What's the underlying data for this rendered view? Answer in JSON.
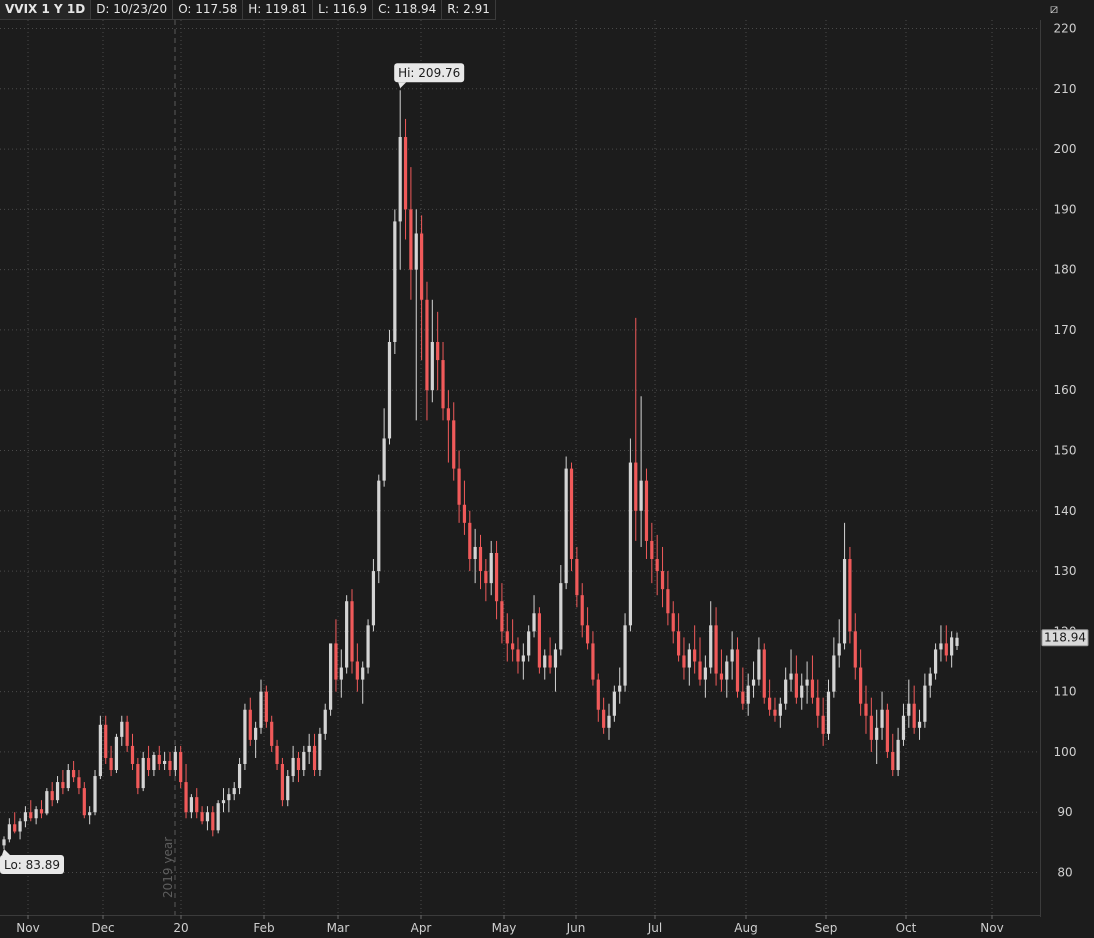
{
  "header": {
    "symbol": "VVIX 1 Y 1D",
    "date": "D: 10/23/20",
    "open": "O: 117.58",
    "high": "H: 119.81",
    "low": "L: 116.9",
    "close": "C: 118.94",
    "range": "R: 2.91"
  },
  "toolbar": {
    "icon": "style-icon"
  },
  "chart_data": {
    "type": "candlestick",
    "y_ticks": [
      "80",
      "90",
      "100",
      "110",
      "120",
      "130",
      "140",
      "150",
      "160",
      "170",
      "180",
      "190",
      "200",
      "210",
      "220"
    ],
    "ylim": [
      74.5,
      222.5
    ],
    "x_labels": [
      "Nov",
      "Dec",
      "20",
      "Feb",
      "Mar",
      "Apr",
      "May",
      "Jun",
      "Jul",
      "Aug",
      "Sep",
      "Oct",
      "Nov"
    ],
    "year_marker": "2019 year",
    "last_price": "118.94",
    "hi_label": "Hi: 209.76",
    "lo_label": "Lo: 83.89",
    "hi_value": 209.76,
    "lo_value": 83.89,
    "grid": true,
    "colors": {
      "up": "#d4d4d4",
      "down": "#f05a5a",
      "grid": "#4a4a4a",
      "background": "#1c1c1c",
      "axis_text": "#cfcfcf"
    },
    "candles": [
      [
        84.5,
        86,
        83.89,
        85.5
      ],
      [
        85.5,
        89,
        85,
        88
      ],
      [
        88,
        90,
        86.5,
        86.8
      ],
      [
        86.8,
        89,
        85.5,
        88.5
      ],
      [
        88.5,
        91,
        87.5,
        90
      ],
      [
        90,
        92,
        88.5,
        89
      ],
      [
        89,
        91,
        88,
        90.5
      ],
      [
        90.5,
        92,
        89,
        89.8
      ],
      [
        89.8,
        94,
        89.5,
        93.5
      ],
      [
        93.5,
        95,
        91,
        92
      ],
      [
        92,
        96,
        91.5,
        95
      ],
      [
        95,
        97,
        93,
        94
      ],
      [
        94,
        98,
        93.5,
        97
      ],
      [
        97,
        98.5,
        95,
        95.8
      ],
      [
        95.8,
        97,
        93,
        94
      ],
      [
        94,
        95,
        89,
        89.5
      ],
      [
        89.5,
        91,
        88,
        90
      ],
      [
        90,
        97,
        89.5,
        96
      ],
      [
        96,
        106,
        95.5,
        104.5
      ],
      [
        104.5,
        106,
        98,
        99
      ],
      [
        99,
        101,
        96,
        97
      ],
      [
        97,
        103,
        96.5,
        102.5
      ],
      [
        102.5,
        106,
        101,
        105
      ],
      [
        105,
        106,
        100,
        101
      ],
      [
        101,
        103,
        97,
        98
      ],
      [
        98,
        99,
        93,
        94
      ],
      [
        94,
        100,
        93.5,
        99
      ],
      [
        99,
        101,
        96,
        97
      ],
      [
        97,
        100,
        96,
        99.5
      ],
      [
        99.5,
        101,
        97,
        98
      ],
      [
        98,
        100,
        97,
        98.5
      ],
      [
        98.5,
        100,
        96,
        97
      ],
      [
        97,
        101,
        96,
        100
      ],
      [
        100,
        101,
        94,
        95
      ],
      [
        95,
        98,
        89,
        90
      ],
      [
        90,
        93,
        89,
        92.5
      ],
      [
        92.5,
        94,
        89,
        90
      ],
      [
        90,
        91,
        88,
        88.5
      ],
      [
        88.5,
        91,
        87,
        90
      ],
      [
        90,
        91,
        86,
        87
      ],
      [
        87,
        92,
        86.5,
        91.5
      ],
      [
        91.5,
        94,
        90,
        92
      ],
      [
        92,
        94,
        90,
        93
      ],
      [
        93,
        95,
        92,
        94
      ],
      [
        94,
        99,
        93,
        98
      ],
      [
        98,
        108,
        97,
        107
      ],
      [
        107,
        109,
        101,
        102
      ],
      [
        102,
        105,
        99,
        104
      ],
      [
        104,
        112,
        103,
        110
      ],
      [
        110,
        111,
        104,
        105
      ],
      [
        105,
        106,
        100,
        101
      ],
      [
        101,
        102,
        97,
        98
      ],
      [
        98,
        99,
        91,
        92
      ],
      [
        92,
        97,
        91,
        96
      ],
      [
        96,
        101,
        95,
        99
      ],
      [
        99,
        100,
        95,
        97
      ],
      [
        97,
        101,
        96,
        100
      ],
      [
        100,
        103,
        98,
        101
      ],
      [
        101,
        103,
        96,
        97
      ],
      [
        97,
        104,
        96,
        103
      ],
      [
        103,
        108,
        102,
        107
      ],
      [
        107,
        115,
        106,
        118
      ],
      [
        118,
        122,
        110,
        112
      ],
      [
        112,
        117,
        109,
        114
      ],
      [
        114,
        126,
        113,
        125
      ],
      [
        125,
        127,
        113,
        115
      ],
      [
        115,
        118,
        110,
        112
      ],
      [
        112,
        115,
        108,
        114
      ],
      [
        114,
        122,
        113,
        121
      ],
      [
        121,
        132,
        120,
        130
      ],
      [
        130,
        146,
        128,
        145
      ],
      [
        145,
        157,
        144,
        152
      ],
      [
        152,
        170,
        151,
        168
      ],
      [
        168,
        190,
        166,
        188
      ],
      [
        188,
        209.76,
        180,
        202
      ],
      [
        202,
        205,
        185,
        190
      ],
      [
        190,
        197,
        175,
        180
      ],
      [
        180,
        190,
        155,
        186
      ],
      [
        186,
        189,
        165,
        175
      ],
      [
        175,
        178,
        155,
        160
      ],
      [
        160,
        175,
        158,
        168
      ],
      [
        168,
        173,
        160,
        165
      ],
      [
        165,
        168,
        155,
        157
      ],
      [
        157,
        160,
        148,
        155
      ],
      [
        155,
        158,
        145,
        147
      ],
      [
        147,
        150,
        138,
        141
      ],
      [
        141,
        145,
        136,
        138
      ],
      [
        138,
        140,
        130,
        132
      ],
      [
        132,
        137,
        128,
        134
      ],
      [
        134,
        136,
        127,
        130
      ],
      [
        130,
        132,
        125,
        128
      ],
      [
        128,
        135,
        126,
        133
      ],
      [
        133,
        135,
        122,
        125
      ],
      [
        125,
        128,
        118,
        120
      ],
      [
        120,
        123,
        115,
        118
      ],
      [
        118,
        122,
        115,
        117
      ],
      [
        117,
        119,
        113,
        115
      ],
      [
        115,
        118,
        112,
        116
      ],
      [
        116,
        121,
        115,
        120
      ],
      [
        120,
        126,
        119,
        123
      ],
      [
        123,
        124,
        113,
        114
      ],
      [
        114,
        117,
        112,
        116
      ],
      [
        116,
        119,
        113,
        114
      ],
      [
        114,
        118,
        110,
        117
      ],
      [
        117,
        131,
        116,
        128
      ],
      [
        128,
        149,
        127,
        147
      ],
      [
        147,
        148,
        130,
        132
      ],
      [
        132,
        134,
        124,
        126
      ],
      [
        126,
        128,
        119,
        121
      ],
      [
        121,
        124,
        117,
        118
      ],
      [
        118,
        120,
        111,
        112
      ],
      [
        112,
        113,
        105,
        107
      ],
      [
        107,
        109,
        103,
        104
      ],
      [
        104,
        108,
        102,
        106
      ],
      [
        106,
        111,
        105,
        110
      ],
      [
        110,
        114,
        108,
        111
      ],
      [
        111,
        123,
        110,
        121
      ],
      [
        121,
        152,
        120,
        148
      ],
      [
        148,
        172,
        135,
        140
      ],
      [
        140,
        159,
        134,
        145
      ],
      [
        145,
        147,
        132,
        135
      ],
      [
        135,
        138,
        128,
        132
      ],
      [
        132,
        136,
        126,
        130
      ],
      [
        130,
        134,
        124,
        127
      ],
      [
        127,
        130,
        121,
        123
      ],
      [
        123,
        125,
        118,
        120
      ],
      [
        120,
        123,
        115,
        116
      ],
      [
        116,
        119,
        112,
        114
      ],
      [
        114,
        118,
        111,
        117
      ],
      [
        117,
        121,
        113,
        115
      ],
      [
        115,
        119,
        111,
        112
      ],
      [
        112,
        116,
        109,
        114
      ],
      [
        114,
        125,
        113,
        121
      ],
      [
        121,
        124,
        111,
        113
      ],
      [
        113,
        117,
        110,
        112
      ],
      [
        112,
        116,
        109,
        115
      ],
      [
        115,
        120,
        112,
        117
      ],
      [
        117,
        119,
        109,
        110
      ],
      [
        110,
        114,
        107,
        108
      ],
      [
        108,
        113,
        106,
        111
      ],
      [
        111,
        115,
        109,
        112
      ],
      [
        112,
        119,
        111,
        117
      ],
      [
        117,
        118,
        108,
        109
      ],
      [
        109,
        112,
        106,
        107
      ],
      [
        107,
        109,
        105,
        106
      ],
      [
        106,
        109,
        104,
        108
      ],
      [
        108,
        114,
        107,
        112
      ],
      [
        112,
        117,
        110,
        113
      ],
      [
        113,
        116,
        108,
        109
      ],
      [
        109,
        113,
        107,
        111
      ],
      [
        111,
        115,
        108,
        112
      ],
      [
        112,
        116,
        108,
        109
      ],
      [
        109,
        112,
        104,
        106
      ],
      [
        106,
        109,
        101,
        103
      ],
      [
        103,
        112,
        102,
        110
      ],
      [
        110,
        119,
        109,
        116
      ],
      [
        116,
        122,
        114,
        118
      ],
      [
        118,
        138,
        117,
        132
      ],
      [
        132,
        134,
        118,
        120
      ],
      [
        120,
        123,
        112,
        114
      ],
      [
        114,
        117,
        106,
        108
      ],
      [
        108,
        111,
        103,
        106
      ],
      [
        106,
        109,
        100,
        102
      ],
      [
        102,
        107,
        98,
        104
      ],
      [
        104,
        110,
        102,
        107
      ],
      [
        107,
        108,
        99,
        100
      ],
      [
        100,
        103,
        96,
        97
      ],
      [
        97,
        104,
        96,
        102
      ],
      [
        102,
        108,
        101,
        106
      ],
      [
        106,
        112,
        104,
        108
      ],
      [
        108,
        111,
        103,
        104
      ],
      [
        104,
        107,
        102,
        105
      ],
      [
        105,
        113,
        104,
        111
      ],
      [
        111,
        114,
        109,
        113
      ],
      [
        113,
        118,
        112,
        117
      ],
      [
        117,
        121,
        115,
        118
      ],
      [
        118,
        121,
        115,
        116
      ],
      [
        116,
        120,
        114,
        119
      ],
      [
        117.58,
        119.81,
        116.9,
        118.94
      ]
    ]
  }
}
